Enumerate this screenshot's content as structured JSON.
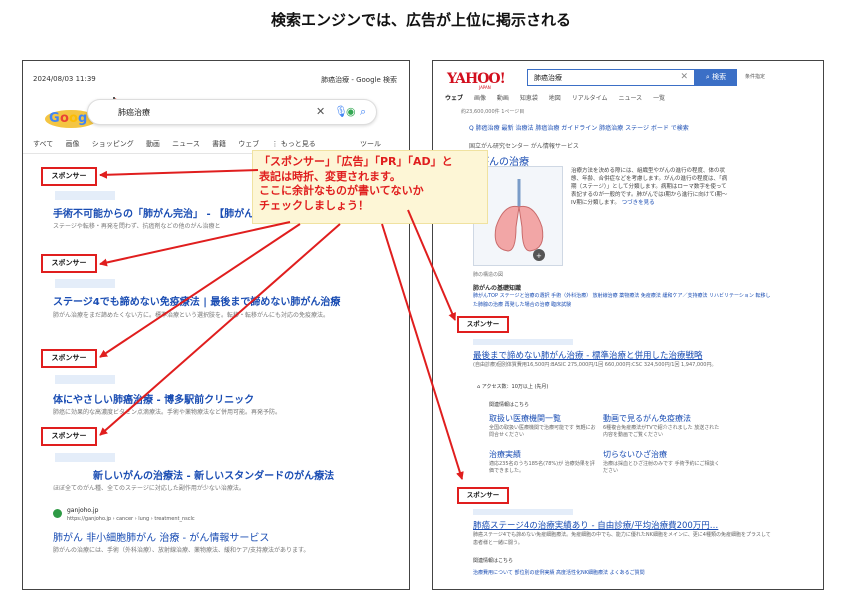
{
  "heading": "検索エンジンでは、広告が上位に掲示される",
  "callout_lines": [
    "「スポンサー」「広告」「PR」「AD」と",
    "表記は時折、変更されます。",
    "ここに余計なものが書いてないか",
    "チェックしましょう！"
  ],
  "colors": {
    "accent_red": "#e01e1e",
    "link_blue": "#1a4db3",
    "callout_bg": "#fdf6d6"
  },
  "google": {
    "date": "2024/08/03 11:39",
    "page_title": "肺癌治療 - Google 検索",
    "query": "肺癌治療",
    "tabs": [
      "すべて",
      "画像",
      "ショッピング",
      "動画",
      "ニュース",
      "書籍",
      "ウェブ",
      "⋮ もっと見る"
    ],
    "tools": "ツール",
    "sponsor_label": "スポンサー",
    "ads": [
      {
        "title": "手術不可能からの「肺がん完治」 - 【肺がん",
        "desc": "ステージや転移・再発を問わず、抗癌剤などの他のがん治療と"
      },
      {
        "title": "ステージ4でも諦めない免疫療法 | 最後まで諦めない肺がん治療",
        "desc": "肺がん治療をまだ諦めたくない方に。標準治療という選択肢を。転移・転移がんにも対応の免疫療法。"
      },
      {
        "title": "体にやさしい肺癌治療 - 博多駅前クリニック",
        "desc": "肺癌に効果的な高濃度ビタミン点滴療法。手術や薬物療法など併用可能。再発予防。"
      },
      {
        "title": "新しいがんの治療法 - 新しいスタンダードのがん療法",
        "desc": "ほぼ全てのがん種、全てのステージに対応した副作用が少ない治療法。"
      }
    ],
    "organic": {
      "site": "ganjoho.jp",
      "url": "https://ganjoho.jp › cancer › lung › treatment_nsclc",
      "title": "肺がん 非小細胞肺がん 治療 - がん情報サービス",
      "desc": "肺がんの治療には、手術（外科治療）、放射線治療、薬物療法、緩和ケア/支持療法があります。"
    }
  },
  "yahoo": {
    "logo": "YAHOO!",
    "logo_sub": "JAPAN",
    "query": "肺癌治療",
    "search_button": "検索",
    "cond": "条件指定",
    "tabs": [
      "ウェブ",
      "画像",
      "動画",
      "知恵袋",
      "地図",
      "リアルタイム",
      "ニュース",
      "一覧"
    ],
    "count": "約23,600,000件 1ページ目",
    "suggest": "Q 肺癌治療 最新 治療法  肺癌治療 ガイドライン  肺癌治療 ステージ ボード で検索",
    "kp_source": "国立がん研究センター がん情報サービス",
    "kp_title": "肺がんの治療",
    "kp_desc": "治療方法を決める際には、組織型やがんの進行の程度、体の状態、年齢、合併症などを考慮します。がんの進行の程度は、「病期（ステージ）」として分類します。病期はローマ数字を使って表記するのが一般的です。肺がんではI期から進行に向けてI期〜IV期に分類します。",
    "kp_more": "つづきを見る",
    "kp_caption": "肺の構造の図",
    "basic_info": "肺がんの基礎知識",
    "basic_links": "肺がんTOP  ステージと治療の選択  手術（外科治療）  放射線治療  薬物療法  免疫療法  緩和ケア／支持療法  リハビリテーション  転移した肺腺の治療  再発した場合の治療  臨床試験",
    "sponsor_label": "スポンサー",
    "ad1": {
      "title": "最後まで諦めない肺がん治療 - 標準治療と併用した治療戦略",
      "desc": "(自由診療)個別体質費用16,500円:BASIC 275,000円/1回 660,000円:CSC 324,500円/1回 1,947,000円。",
      "access": "⌂ アクセス数：10万以上 (先月)",
      "related_label": "関連情報はこちら",
      "related": [
        {
          "title": "取扱い医療機関一覧",
          "desc": "全国の取扱い医療機関で治療可能です 気軽にお問合せください"
        },
        {
          "title": "動画で見るがん免疫療法",
          "desc": "6種複合免疫療法がTVで紹介されました 放送された内容を動画でご覧ください"
        },
        {
          "title": "治療実績",
          "desc": "適応235名のうち185名(78%)が 治療効果を評価できました。"
        },
        {
          "title": "切らないひざ治療",
          "desc": "治療は採血とひざ注射のみです 手術予約にご相談ください"
        }
      ]
    },
    "ad2": {
      "title": "肺癌ステージ4の治療実績あり - 自由診療/平均治療費200万円…",
      "desc": "肺癌ステージ4でも諦めない免疫細胞療法。免疫細胞の中でも、能力に優れたNK細胞をメインに、更に4種類の免疫細胞をプラスして患者様と一緒に闘う。",
      "related_label": "関連情報はこちら",
      "links": "治療費用について  部位別の症例実績  高度活性化NK細胞療法  よくあるご質問"
    }
  }
}
